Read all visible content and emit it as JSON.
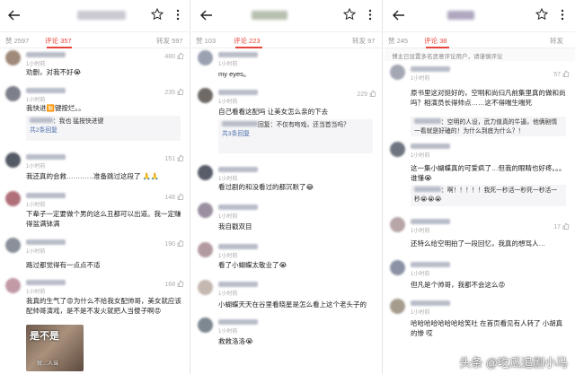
{
  "panels": [
    {
      "stats": {
        "share": "赞 2597",
        "comments": "评论 357",
        "reposts": "转发 597"
      },
      "comments": [
        {
          "time": "1小时前",
          "likes": "480",
          "text": "劝删，对我不好😭"
        },
        {
          "time": "1小时前",
          "likes": "235",
          "text": "我快进🈚键按烂。。",
          "reply": "：我也 猛按快进键",
          "reply_count": "共2条回复"
        },
        {
          "time": "1小时前",
          "likes": "151",
          "text": "我还真的会救…………准备跳过这段了 🙏🙏"
        },
        {
          "time": "1小时前",
          "likes": "148",
          "text": "下辈子一定要做个男的这么丑都可以出道。我一定赚得盆满钵满"
        },
        {
          "time": "1小时前",
          "likes": "190",
          "text": "路过都觉得有一点点不适"
        },
        {
          "time": "1小时前",
          "likes": "168",
          "text": "我真的生气了😡为什么不给我女配帅哥，美女就应该配帅哥演戏，是不是不发火就把人当傻子啊😡",
          "image_text": "是不是",
          "image_sub": "就…人当"
        }
      ]
    },
    {
      "stats": {
        "share": "赞 103",
        "comments": "评论 223",
        "reposts": "转发 97"
      },
      "comments": [
        {
          "time": "1小时前",
          "likes": "",
          "text": "my eyes。"
        },
        {
          "time": "1小时前",
          "likes": "229",
          "text": "自己看看这配吗 让美女怎么亲的下去",
          "reply": "回复：不仅有吻戏，还当首当吗？",
          "reply_count": "共3条回复"
        },
        {
          "time": "1小时前",
          "likes": "",
          "text": "看过剧的和没看过的都沉默了😂"
        },
        {
          "time": "1小时前",
          "likes": "",
          "text": "我自戳双目"
        },
        {
          "time": "1小时前",
          "likes": "",
          "text": "看了小蝴蝶太敬业了😭"
        },
        {
          "time": "1小时前",
          "likes": "",
          "text": "小蝴蝶天天在谷里看晓星是怎么看上这个老头子的"
        },
        {
          "time": "1小时前",
          "likes": "",
          "text": "救救洛洛😭"
        }
      ]
    },
    {
      "stats": {
        "share": "赞 245",
        "comments": "评论 38",
        "reposts": "转发"
      },
      "notice": "博主已设置多名恶意评论用户，请谨慎评论",
      "comments": [
        {
          "time": "1小时前",
          "likes": "57",
          "text": "原书里这对挺好的，空明和尚归凡前集里真的做和尚吗？相演员长得帅点……这不得喘生喘死",
          "reply": "：空明的人设，武力值真的牛逼，他俩剧情一看就是好磕的！为什么到底为什么？！"
        },
        {
          "time": "1小时前",
          "likes": "",
          "text": "这一集小蝴蝶真的可爱疯了…但我的眼睛也好疼。。。谁懂😭",
          "reply": "：啊！！！！！我死一秒活一秒死一秒活一秒😭😭😭"
        },
        {
          "time": "1小时前",
          "likes": "17",
          "text": "还特么给空明拍了一段回忆，我真的想骂人…"
        },
        {
          "time": "1小时前",
          "likes": "",
          "text": "但凡是个帅哥，我都不会这么😡"
        },
        {
          "time": "1小时前",
          "likes": "",
          "text": "哈哈哈哈哈哈哈哈笑吐 在首页看见有人转了 小胡真的惨 哎"
        }
      ]
    }
  ],
  "watermark": "头条 @吃瓜追剧小马"
}
